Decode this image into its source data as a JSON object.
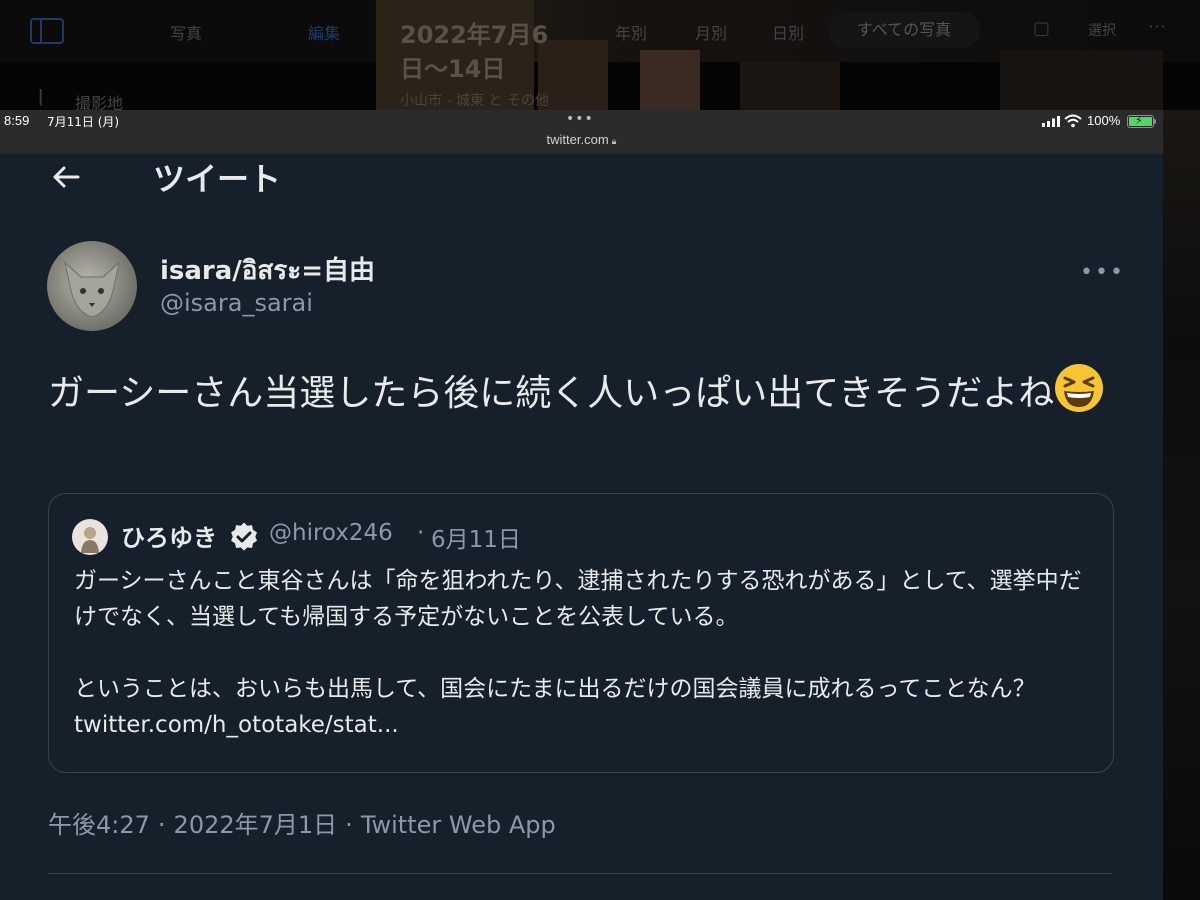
{
  "background_app": {
    "title": "写真",
    "edit_label": "編集",
    "sidebar_item": "撮影地",
    "date_title_line1": "2022年7月6",
    "date_title_line2": "日〜14日",
    "location": "小山市 - 城東 と その他",
    "view_year": "年別",
    "view_month": "月別",
    "view_day": "日別",
    "view_all": "すべての写真",
    "select_label": "選択"
  },
  "status_bar": {
    "time": "8:59",
    "date": "7月11日 (月)",
    "url": "twitter.com",
    "battery": "100%"
  },
  "header": {
    "title": "ツイート"
  },
  "tweet": {
    "display_name": "isara/อิสระ=自由",
    "handle": "@isara_sarai",
    "text": "ガーシーさん当選したら後に続く人いっぱい出てきそうだよね",
    "emoji": "grinning-squinting-face",
    "timestamp": "午後4:27",
    "date": "2022年7月1日",
    "source": "Twitter Web App"
  },
  "quote": {
    "display_name": "ひろゆき",
    "verified": true,
    "handle": "@hirox246",
    "date": "6月11日",
    "paragraph1": "ガーシーさんこと東谷さんは「命を狙われたり、逮捕されたりする恐れがある」として、選挙中だけでなく、当選しても帰国する予定がないことを公表している。",
    "paragraph2": "ということは、おいらも出馬して、国会にたまに出るだけの国会議員に成れるってことなん？ twitter.com/h_ototake/stat..."
  },
  "colors": {
    "background": "#15202b",
    "text_primary": "#e7e9ea",
    "text_secondary": "#8b98a5",
    "border": "#38444d",
    "verified_badge": "#e7e9ea",
    "battery": "#4cd964"
  },
  "icons": [
    "back-arrow-icon",
    "more-icon",
    "verified-badge-icon",
    "lock-icon",
    "signal-icon",
    "wifi-icon",
    "battery-icon"
  ]
}
